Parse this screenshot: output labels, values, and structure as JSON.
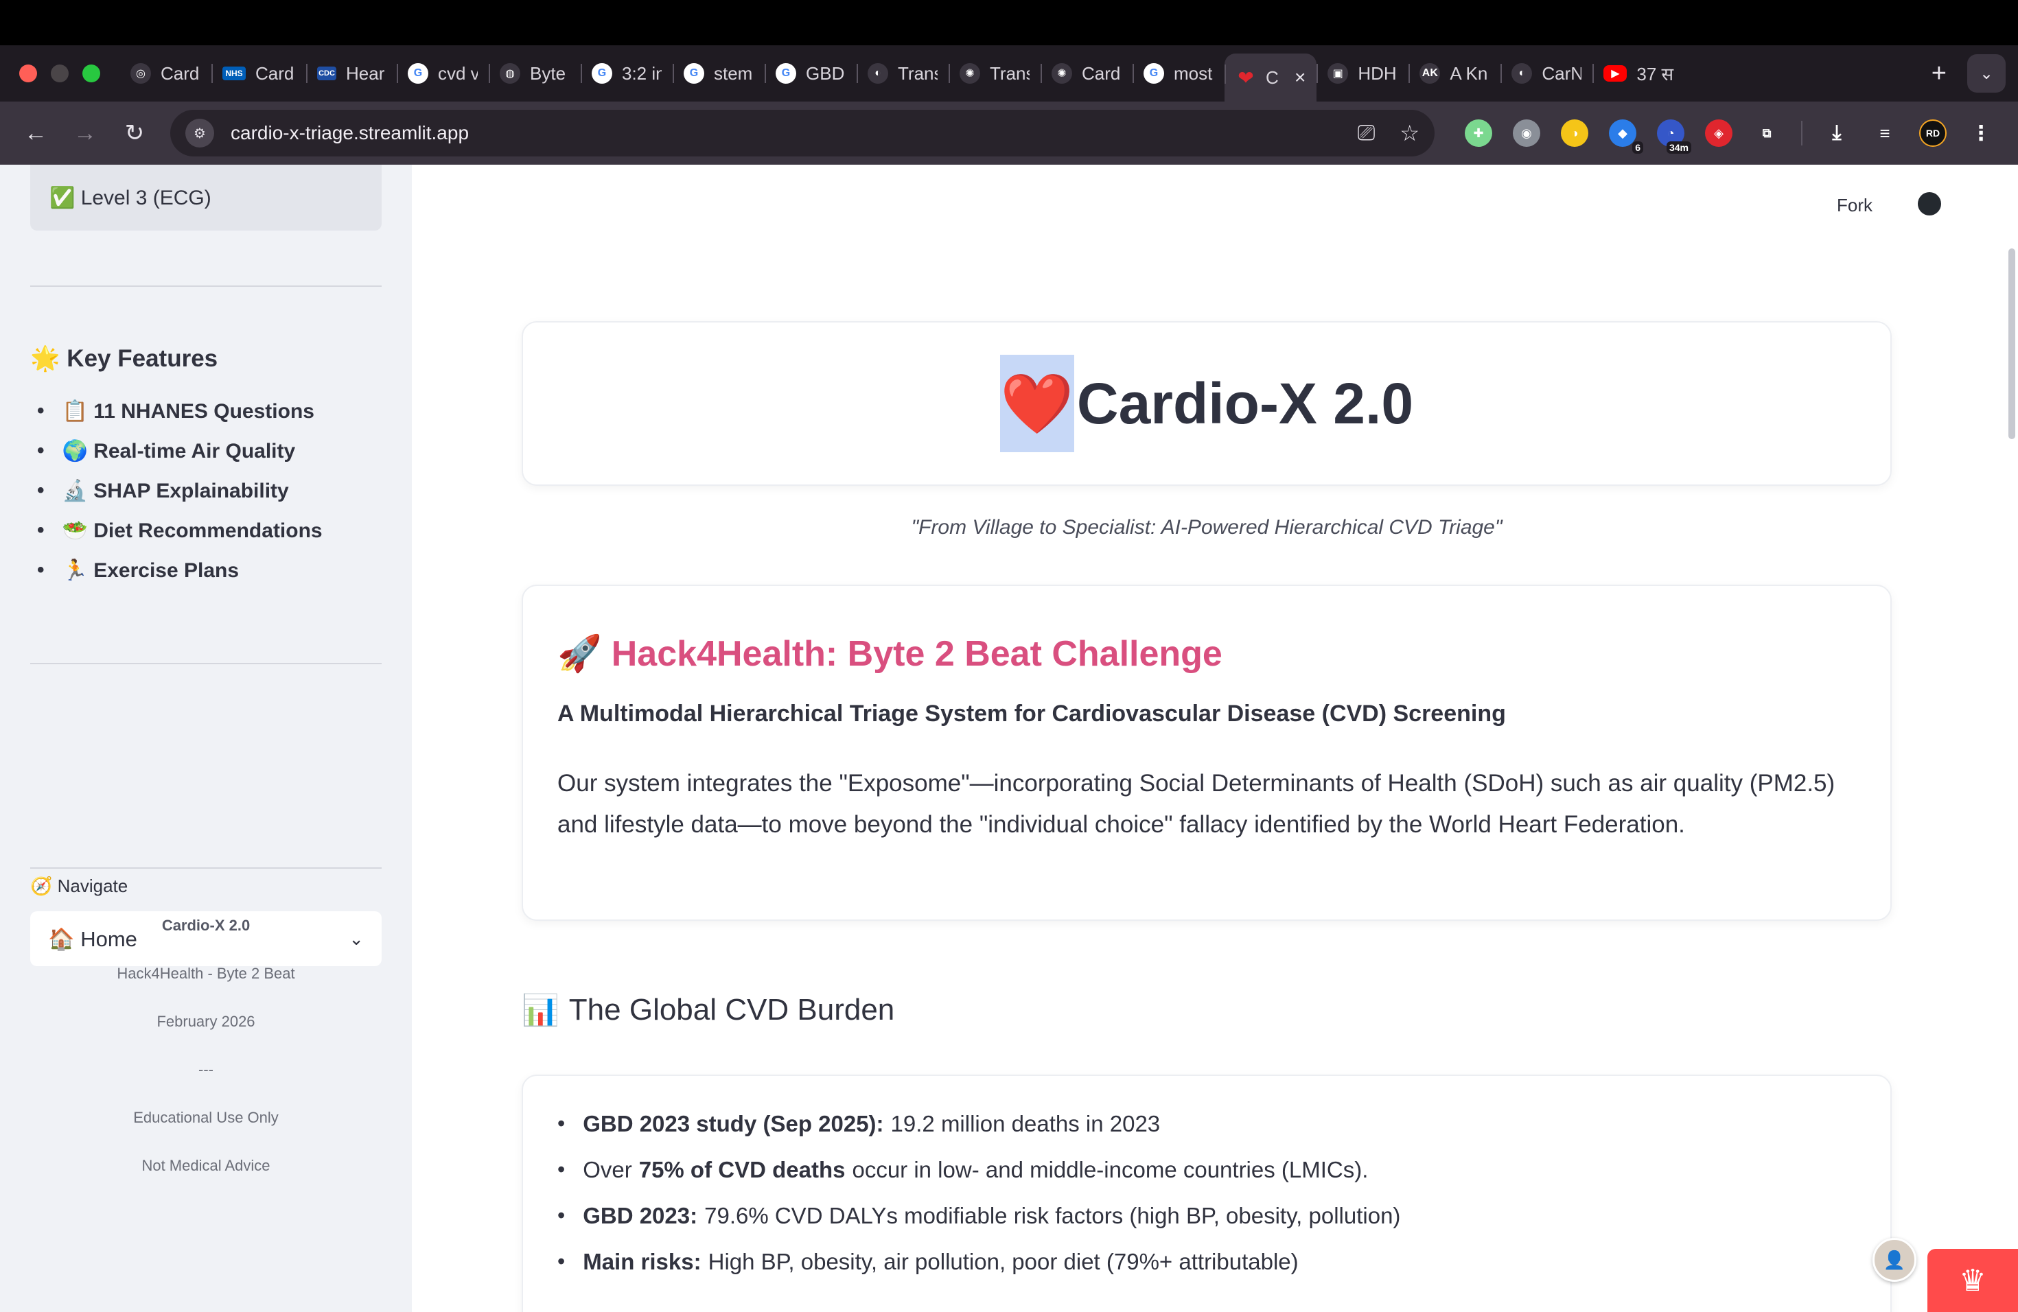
{
  "browser": {
    "tabs": [
      {
        "title": "Card",
        "icon": "globe-icon",
        "glyph": "◎",
        "kind": ""
      },
      {
        "title": "Card",
        "icon": "nhs-icon",
        "glyph": "NHS",
        "kind": "nhs"
      },
      {
        "title": "Hear",
        "icon": "cdc-icon",
        "glyph": "CDC",
        "kind": "cdc"
      },
      {
        "title": "cvd v",
        "icon": "google-icon",
        "glyph": "G",
        "kind": "google"
      },
      {
        "title": "Byte",
        "icon": "fingerprint-icon",
        "glyph": "◍",
        "kind": ""
      },
      {
        "title": "3:2 in",
        "icon": "google-icon",
        "glyph": "G",
        "kind": "google"
      },
      {
        "title": "stem",
        "icon": "google-icon",
        "glyph": "G",
        "kind": "google"
      },
      {
        "title": "GBD",
        "icon": "google-icon",
        "glyph": "G",
        "kind": "google"
      },
      {
        "title": "Trans",
        "icon": "globe-icon",
        "glyph": "◐",
        "kind": ""
      },
      {
        "title": "Trans",
        "icon": "openai-icon",
        "glyph": "✺",
        "kind": ""
      },
      {
        "title": "Card",
        "icon": "openai-icon",
        "glyph": "✺",
        "kind": ""
      },
      {
        "title": "most",
        "icon": "google-icon",
        "glyph": "G",
        "kind": "google"
      },
      {
        "title": "C",
        "icon": "heart-icon",
        "glyph": "❤",
        "kind": "heart",
        "active": true
      },
      {
        "title": "HDH",
        "icon": "pdf-icon",
        "glyph": "▣",
        "kind": ""
      },
      {
        "title": "A Kn",
        "icon": "ak-icon",
        "glyph": "AK",
        "kind": ""
      },
      {
        "title": "CarN",
        "icon": "globe-icon",
        "glyph": "◐",
        "kind": ""
      },
      {
        "title": "37 स",
        "icon": "youtube-icon",
        "glyph": "▶",
        "kind": "yt"
      }
    ],
    "url": "cardio-x-triage.streamlit.app",
    "extensions": [
      {
        "icon": "grid-extension-icon",
        "glyph": "✚",
        "color": "#7bd88f"
      },
      {
        "icon": "owl-extension-icon",
        "glyph": "◉",
        "color": "#8a8f98"
      },
      {
        "icon": "moon-extension-icon",
        "glyph": "◑",
        "color": "#f5c518"
      },
      {
        "icon": "profile-extension-icon",
        "glyph": "◆",
        "color": "#2b7de9",
        "badge": "6"
      },
      {
        "icon": "timer-extension-icon",
        "glyph": "◔",
        "color": "#3557c8",
        "badge": "34m"
      },
      {
        "icon": "red-extension-icon",
        "glyph": "◈",
        "color": "#e0262e"
      },
      {
        "icon": "puzzle-extensions-icon",
        "glyph": "⧉",
        "color": "transparent"
      }
    ],
    "profile_initials": "RD"
  },
  "sidebar": {
    "level_item": "✅ Level 3 (ECG)",
    "key_features_heading": "🌟 Key Features",
    "features": [
      "📋 11 NHANES Questions",
      "🌍 Real-time Air Quality",
      "🔬 SHAP Explainability",
      "🥗 Diet Recommendations",
      "🏃 Exercise Plans"
    ],
    "navigate_label": "🧭 Navigate",
    "navigate_selected": "🏠 Home",
    "footer": {
      "app_name": "Cardio-X 2.0",
      "event": "Hack4Health - Byte 2 Beat",
      "date": "February 2026",
      "separator": "---",
      "disclaimer_1": "Educational Use Only",
      "disclaimer_2": "Not Medical Advice"
    }
  },
  "main": {
    "fork_label": "Fork",
    "title_emoji": "❤️",
    "title_text": "Cardio-X 2.0",
    "tagline": "\"From Village to Specialist: AI-Powered Hierarchical CVD Triage\"",
    "challenge": {
      "emoji": "🚀",
      "title": "Hack4Health: Byte 2 Beat Challenge",
      "subtitle": "A Multimodal Hierarchical Triage System for Cardiovascular Disease (CVD) Screening",
      "body": "Our system integrates the \"Exposome\"—incorporating Social Determinants of Health (SDoH) such as air quality (PM2.5) and lifestyle data—to move beyond the \"individual choice\" fallacy identified by the World Heart Federation."
    },
    "burden": {
      "emoji": "📊",
      "heading": "The Global CVD Burden",
      "items": [
        {
          "bold": "GBD 2023 study (Sep 2025):",
          "text": "19.2 million deaths in 2023"
        },
        {
          "pre": "Over",
          "bold": "75% of CVD deaths",
          "text": "occur in low- and middle-income countries (LMICs)."
        },
        {
          "bold": "GBD 2023:",
          "text": "79.6% CVD DALYs modifiable risk factors (high BP, obesity, pollution)"
        },
        {
          "bold": "Main risks:",
          "text": "High BP, obesity, air pollution, poor diet (79%+ attributable)"
        }
      ]
    }
  }
}
